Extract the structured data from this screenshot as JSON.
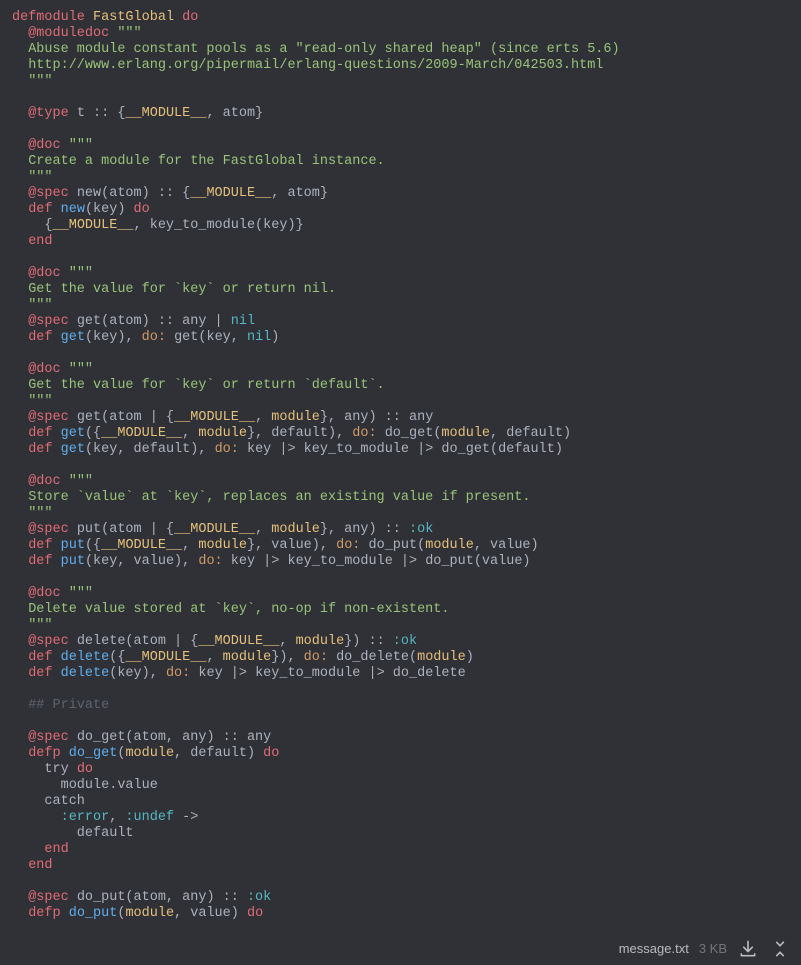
{
  "filename": "message.txt",
  "filesize": "3 KB",
  "lines": [
    [
      [
        "kw-def",
        "defmodule"
      ],
      [
        "ident",
        " "
      ],
      [
        "kw-mod",
        "FastGlobal"
      ],
      [
        "ident",
        " "
      ],
      [
        "kw-do",
        "do"
      ]
    ],
    [
      [
        "ident",
        "  "
      ],
      [
        "at-attr",
        "@moduledoc"
      ],
      [
        "ident",
        " "
      ],
      [
        "str",
        "\"\"\""
      ]
    ],
    [
      [
        "str",
        "  Abuse module constant pools as a \"read-only shared heap\" (since erts 5.6)"
      ]
    ],
    [
      [
        "str",
        "  http://www.erlang.org/pipermail/erlang-questions/2009-March/042503.html"
      ]
    ],
    [
      [
        "str",
        "  \"\"\""
      ]
    ],
    [
      [
        "ident",
        ""
      ]
    ],
    [
      [
        "ident",
        "  "
      ],
      [
        "at-attr",
        "@type"
      ],
      [
        "ident",
        " t :: {"
      ],
      [
        "kw-mod",
        "__MODULE__"
      ],
      [
        "ident",
        ", atom}"
      ]
    ],
    [
      [
        "ident",
        ""
      ]
    ],
    [
      [
        "ident",
        "  "
      ],
      [
        "at-attr",
        "@doc"
      ],
      [
        "ident",
        " "
      ],
      [
        "str",
        "\"\"\""
      ]
    ],
    [
      [
        "str",
        "  Create a module for the FastGlobal instance."
      ]
    ],
    [
      [
        "str",
        "  \"\"\""
      ]
    ],
    [
      [
        "ident",
        "  "
      ],
      [
        "at-attr",
        "@spec"
      ],
      [
        "ident",
        " new(atom) :: {"
      ],
      [
        "kw-mod",
        "__MODULE__"
      ],
      [
        "ident",
        ", atom}"
      ]
    ],
    [
      [
        "ident",
        "  "
      ],
      [
        "kw-def",
        "def"
      ],
      [
        "ident",
        " "
      ],
      [
        "fn-call",
        "new"
      ],
      [
        "ident",
        "(key) "
      ],
      [
        "kw-do",
        "do"
      ]
    ],
    [
      [
        "ident",
        "    {"
      ],
      [
        "kw-mod",
        "__MODULE__"
      ],
      [
        "ident",
        ", key_to_module(key)}"
      ]
    ],
    [
      [
        "ident",
        "  "
      ],
      [
        "kw-def",
        "end"
      ]
    ],
    [
      [
        "ident",
        ""
      ]
    ],
    [
      [
        "ident",
        "  "
      ],
      [
        "at-attr",
        "@doc"
      ],
      [
        "ident",
        " "
      ],
      [
        "str",
        "\"\"\""
      ]
    ],
    [
      [
        "str",
        "  Get the value for `key` or return nil."
      ]
    ],
    [
      [
        "str",
        "  \"\"\""
      ]
    ],
    [
      [
        "ident",
        "  "
      ],
      [
        "at-attr",
        "@spec"
      ],
      [
        "ident",
        " get(atom) :: any | "
      ],
      [
        "atom",
        "nil"
      ]
    ],
    [
      [
        "ident",
        "  "
      ],
      [
        "kw-def",
        "def"
      ],
      [
        "ident",
        " "
      ],
      [
        "fn-call",
        "get"
      ],
      [
        "ident",
        "(key), "
      ],
      [
        "sym",
        "do:"
      ],
      [
        "ident",
        " get(key, "
      ],
      [
        "atom",
        "nil"
      ],
      [
        "ident",
        ")"
      ]
    ],
    [
      [
        "ident",
        ""
      ]
    ],
    [
      [
        "ident",
        "  "
      ],
      [
        "at-attr",
        "@doc"
      ],
      [
        "ident",
        " "
      ],
      [
        "str",
        "\"\"\""
      ]
    ],
    [
      [
        "str",
        "  Get the value for `key` or return `default`."
      ]
    ],
    [
      [
        "str",
        "  \"\"\""
      ]
    ],
    [
      [
        "ident",
        "  "
      ],
      [
        "at-attr",
        "@spec"
      ],
      [
        "ident",
        " get(atom | {"
      ],
      [
        "kw-mod",
        "__MODULE__"
      ],
      [
        "ident",
        ", "
      ],
      [
        "mod-ref",
        "module"
      ],
      [
        "ident",
        "}, any) :: any"
      ]
    ],
    [
      [
        "ident",
        "  "
      ],
      [
        "kw-def",
        "def"
      ],
      [
        "ident",
        " "
      ],
      [
        "fn-call",
        "get"
      ],
      [
        "ident",
        "({"
      ],
      [
        "kw-mod",
        "__MODULE__"
      ],
      [
        "ident",
        ", "
      ],
      [
        "mod-ref",
        "module"
      ],
      [
        "ident",
        "}, default), "
      ],
      [
        "sym",
        "do:"
      ],
      [
        "ident",
        " do_get("
      ],
      [
        "mod-ref",
        "module"
      ],
      [
        "ident",
        ", default)"
      ]
    ],
    [
      [
        "ident",
        "  "
      ],
      [
        "kw-def",
        "def"
      ],
      [
        "ident",
        " "
      ],
      [
        "fn-call",
        "get"
      ],
      [
        "ident",
        "(key, default), "
      ],
      [
        "sym",
        "do:"
      ],
      [
        "ident",
        " key |> key_to_module |> do_get(default)"
      ]
    ],
    [
      [
        "ident",
        ""
      ]
    ],
    [
      [
        "ident",
        "  "
      ],
      [
        "at-attr",
        "@doc"
      ],
      [
        "ident",
        " "
      ],
      [
        "str",
        "\"\"\""
      ]
    ],
    [
      [
        "str",
        "  Store `value` at `key`, replaces an existing value if present."
      ]
    ],
    [
      [
        "str",
        "  \"\"\""
      ]
    ],
    [
      [
        "ident",
        "  "
      ],
      [
        "at-attr",
        "@spec"
      ],
      [
        "ident",
        " put(atom | {"
      ],
      [
        "kw-mod",
        "__MODULE__"
      ],
      [
        "ident",
        ", "
      ],
      [
        "mod-ref",
        "module"
      ],
      [
        "ident",
        "}, any) :: "
      ],
      [
        "atom",
        ":ok"
      ]
    ],
    [
      [
        "ident",
        "  "
      ],
      [
        "kw-def",
        "def"
      ],
      [
        "ident",
        " "
      ],
      [
        "fn-call",
        "put"
      ],
      [
        "ident",
        "({"
      ],
      [
        "kw-mod",
        "__MODULE__"
      ],
      [
        "ident",
        ", "
      ],
      [
        "mod-ref",
        "module"
      ],
      [
        "ident",
        "}, value), "
      ],
      [
        "sym",
        "do:"
      ],
      [
        "ident",
        " do_put("
      ],
      [
        "mod-ref",
        "module"
      ],
      [
        "ident",
        ", value)"
      ]
    ],
    [
      [
        "ident",
        "  "
      ],
      [
        "kw-def",
        "def"
      ],
      [
        "ident",
        " "
      ],
      [
        "fn-call",
        "put"
      ],
      [
        "ident",
        "(key, value), "
      ],
      [
        "sym",
        "do:"
      ],
      [
        "ident",
        " key |> key_to_module |> do_put(value)"
      ]
    ],
    [
      [
        "ident",
        ""
      ]
    ],
    [
      [
        "ident",
        "  "
      ],
      [
        "at-attr",
        "@doc"
      ],
      [
        "ident",
        " "
      ],
      [
        "str",
        "\"\"\""
      ]
    ],
    [
      [
        "str",
        "  Delete value stored at `key`, no-op if non-existent."
      ]
    ],
    [
      [
        "str",
        "  \"\"\""
      ]
    ],
    [
      [
        "ident",
        "  "
      ],
      [
        "at-attr",
        "@spec"
      ],
      [
        "ident",
        " delete(atom | {"
      ],
      [
        "kw-mod",
        "__MODULE__"
      ],
      [
        "ident",
        ", "
      ],
      [
        "mod-ref",
        "module"
      ],
      [
        "ident",
        "}) :: "
      ],
      [
        "atom",
        ":ok"
      ]
    ],
    [
      [
        "ident",
        "  "
      ],
      [
        "kw-def",
        "def"
      ],
      [
        "ident",
        " "
      ],
      [
        "fn-call",
        "delete"
      ],
      [
        "ident",
        "({"
      ],
      [
        "kw-mod",
        "__MODULE__"
      ],
      [
        "ident",
        ", "
      ],
      [
        "mod-ref",
        "module"
      ],
      [
        "ident",
        "}), "
      ],
      [
        "sym",
        "do:"
      ],
      [
        "ident",
        " do_delete("
      ],
      [
        "mod-ref",
        "module"
      ],
      [
        "ident",
        ")"
      ]
    ],
    [
      [
        "ident",
        "  "
      ],
      [
        "kw-def",
        "def"
      ],
      [
        "ident",
        " "
      ],
      [
        "fn-call",
        "delete"
      ],
      [
        "ident",
        "(key), "
      ],
      [
        "sym",
        "do:"
      ],
      [
        "ident",
        " key |> key_to_module |> do_delete"
      ]
    ],
    [
      [
        "ident",
        ""
      ]
    ],
    [
      [
        "ident",
        "  "
      ],
      [
        "comment",
        "## Private"
      ]
    ],
    [
      [
        "ident",
        ""
      ]
    ],
    [
      [
        "ident",
        "  "
      ],
      [
        "at-attr",
        "@spec"
      ],
      [
        "ident",
        " do_get(atom, any) :: any"
      ]
    ],
    [
      [
        "ident",
        "  "
      ],
      [
        "kw-def",
        "defp"
      ],
      [
        "ident",
        " "
      ],
      [
        "fn-call",
        "do_get"
      ],
      [
        "ident",
        "("
      ],
      [
        "mod-ref",
        "module"
      ],
      [
        "ident",
        ", default) "
      ],
      [
        "kw-do",
        "do"
      ]
    ],
    [
      [
        "ident",
        "    try "
      ],
      [
        "kw-do",
        "do"
      ]
    ],
    [
      [
        "ident",
        "      module.value"
      ]
    ],
    [
      [
        "ident",
        "    catch"
      ]
    ],
    [
      [
        "ident",
        "      "
      ],
      [
        "atom",
        ":error"
      ],
      [
        "ident",
        ", "
      ],
      [
        "atom",
        ":undef"
      ],
      [
        "ident",
        " ->"
      ]
    ],
    [
      [
        "ident",
        "        default"
      ]
    ],
    [
      [
        "ident",
        "    "
      ],
      [
        "kw-def",
        "end"
      ]
    ],
    [
      [
        "ident",
        "  "
      ],
      [
        "kw-def",
        "end"
      ]
    ],
    [
      [
        "ident",
        ""
      ]
    ],
    [
      [
        "ident",
        "  "
      ],
      [
        "at-attr",
        "@spec"
      ],
      [
        "ident",
        " do_put(atom, any) :: "
      ],
      [
        "atom",
        ":ok"
      ]
    ],
    [
      [
        "ident",
        "  "
      ],
      [
        "kw-def",
        "defp"
      ],
      [
        "ident",
        " "
      ],
      [
        "fn-call",
        "do_put"
      ],
      [
        "ident",
        "("
      ],
      [
        "mod-ref",
        "module"
      ],
      [
        "ident",
        ", value) "
      ],
      [
        "kw-do",
        "do"
      ]
    ]
  ]
}
